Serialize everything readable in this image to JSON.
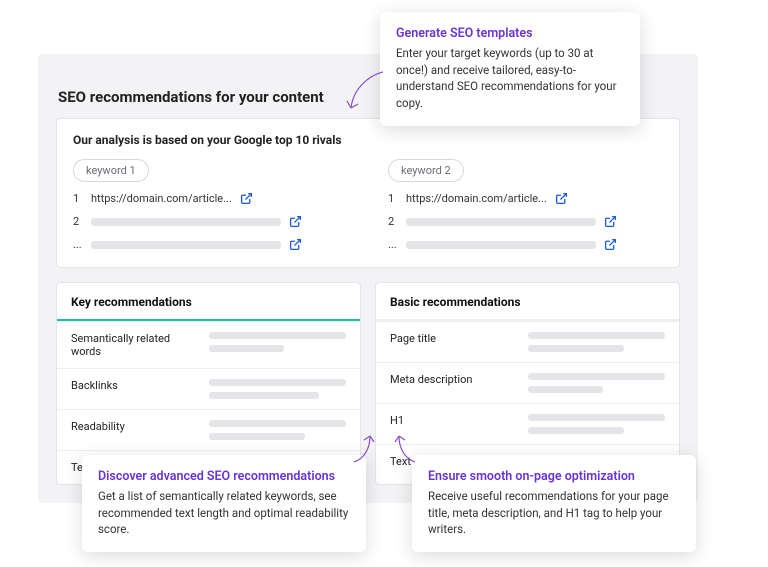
{
  "page_title": "SEO recommendations for your content",
  "analysis": {
    "heading": "Our analysis is based on your Google top 10 rivals",
    "cols": [
      {
        "chip": "keyword 1",
        "rows": [
          "1",
          "2",
          "..."
        ],
        "url": "https://domain.com/article..."
      },
      {
        "chip": "keyword 2",
        "rows": [
          "1",
          "2",
          "..."
        ],
        "url": "https://domain.com/article..."
      }
    ]
  },
  "key": {
    "heading": "Key recommendations",
    "items": [
      "Semantically related words",
      "Backlinks",
      "Readability",
      "Text length"
    ]
  },
  "basic": {
    "heading": "Basic recommendations",
    "items": [
      "Page title",
      "Meta description",
      "H1",
      "Text"
    ]
  },
  "tips": {
    "generate": {
      "title": "Generate SEO templates",
      "body": "Enter your target keywords (up to 30 at once!) and receive tailored, easy-to-understand SEO recommendations for your copy."
    },
    "advanced": {
      "title": "Discover advanced SEO recommendations",
      "body": "Get a list of semantically related keywords, see recommended text length and optimal readability score."
    },
    "onpage": {
      "title": "Ensure smooth on-page optimization",
      "body": "Receive useful recommendations for your page title, meta description, and H1 tag to help your writers."
    }
  }
}
